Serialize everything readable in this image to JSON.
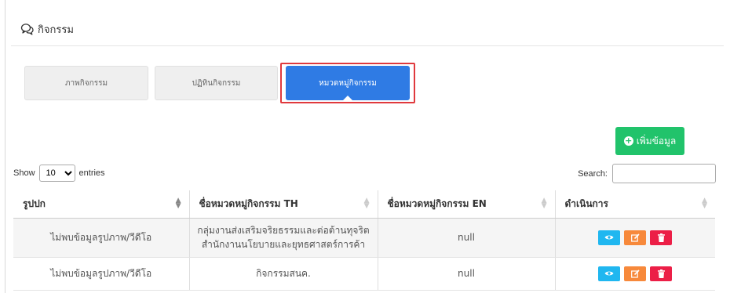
{
  "header": {
    "title": "กิจกรรม",
    "icon": "chat-bubbles-icon"
  },
  "tabs": [
    {
      "label": "ภาพกิจกรรม",
      "active": false
    },
    {
      "label": "ปฏิทินกิจกรรม",
      "active": false
    },
    {
      "label": "หมวดหมู่กิจกรรม",
      "active": true
    }
  ],
  "add_button": {
    "label": "เพิ่มข้อมูล",
    "color": "#21c36b"
  },
  "length_control": {
    "prefix": "Show",
    "value": "10",
    "suffix": "entries"
  },
  "search": {
    "label": "Search:",
    "value": ""
  },
  "table": {
    "columns": [
      "รูปปก",
      "ชื่อหมวดหมู่กิจกรรม TH",
      "ชื่อหมวดหมู่กิจกรรม EN",
      "ดำเนินการ"
    ],
    "rows": [
      {
        "cover": "ไม่พบข้อมูลรูปภาพ/วีดีโอ",
        "name_th": "กลุ่มงานส่งเสริมจริยธรรมและต่อต้านทุจริต สำนักงานนโยบายและยุทธศาสตร์การค้า",
        "name_en": "null"
      },
      {
        "cover": "ไม่พบข้อมูลรูปภาพ/วีดีโอ",
        "name_th": "กิจกรรมสนค.",
        "name_en": "null"
      }
    ]
  },
  "colors": {
    "accent_tab": "#2f7be4",
    "highlight_outline": "#e0393d",
    "view": "#20b7f0",
    "edit": "#f7893b",
    "delete": "#ec1f47"
  }
}
